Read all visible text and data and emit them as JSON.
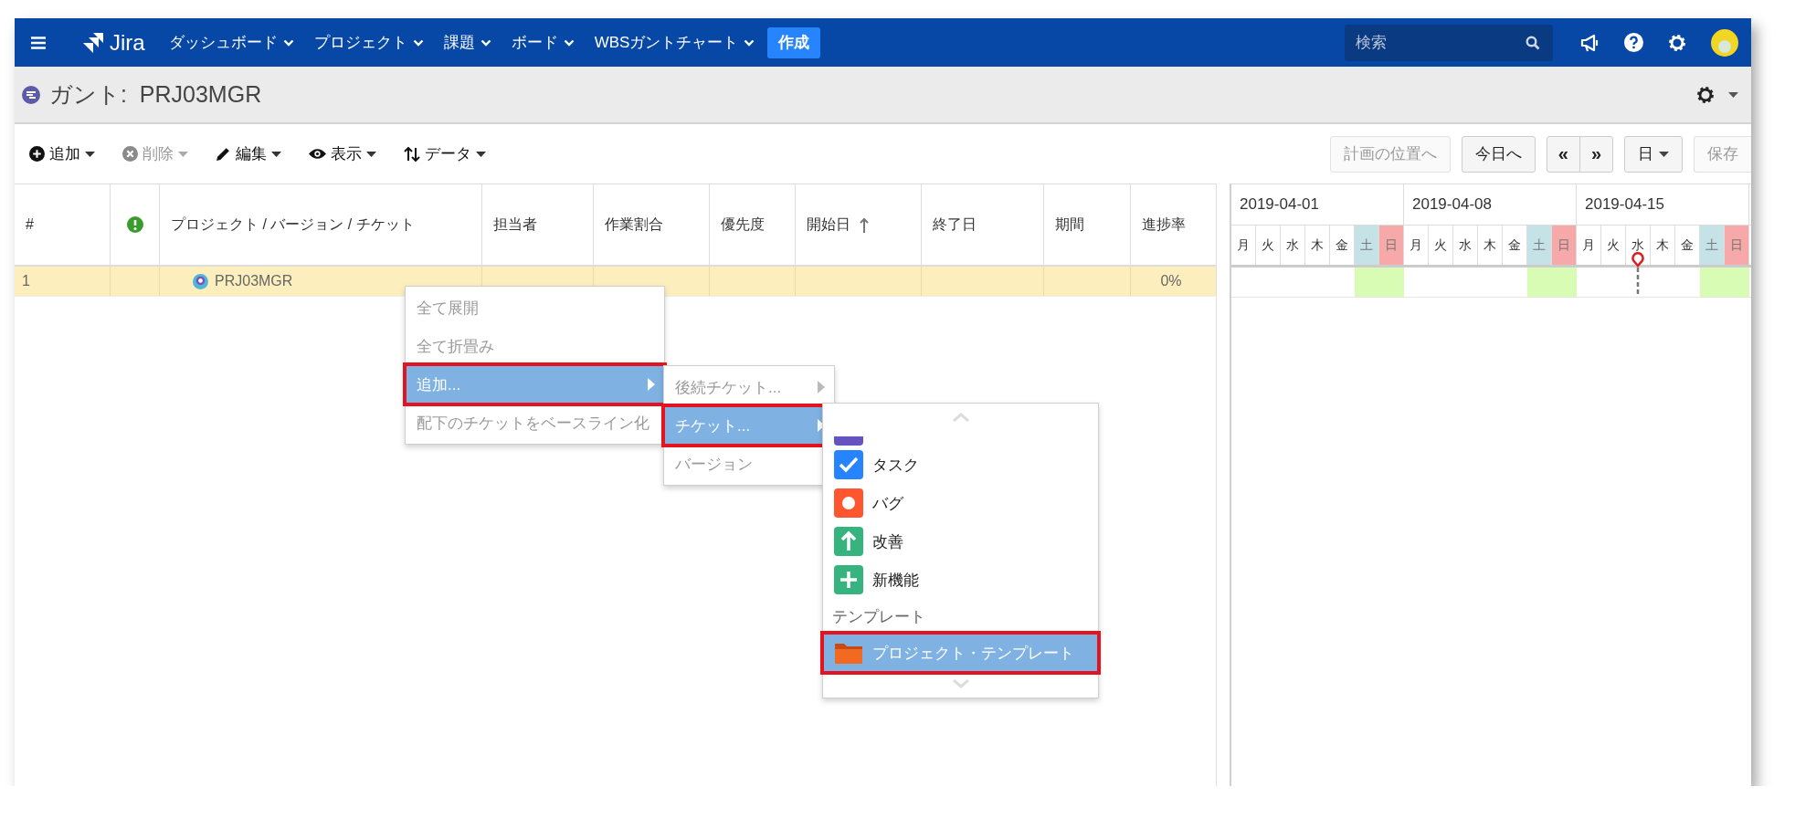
{
  "topbar": {
    "app_name": "Jira",
    "nav": [
      {
        "label": "ダッシュボード"
      },
      {
        "label": "プロジェクト"
      },
      {
        "label": "課題"
      },
      {
        "label": "ボード"
      },
      {
        "label": "WBSガントチャート"
      }
    ],
    "create_button": "作成",
    "search": {
      "placeholder": "検索"
    }
  },
  "title_bar": {
    "title": "ガント:  PRJ03MGR"
  },
  "toolbar": {
    "left": [
      {
        "label": "追加",
        "kind": "add",
        "disabled": false
      },
      {
        "label": "削除",
        "kind": "delete",
        "disabled": true
      },
      {
        "label": "編集",
        "kind": "edit",
        "disabled": false
      },
      {
        "label": "表示",
        "kind": "view",
        "disabled": false
      },
      {
        "label": "データ",
        "kind": "data",
        "disabled": false
      }
    ],
    "right": [
      {
        "label": "計画の位置へ",
        "disabled": true,
        "dropdown": false,
        "joined": false
      },
      {
        "label": "今日へ",
        "disabled": false,
        "dropdown": false,
        "joined": false
      },
      {
        "label": "«",
        "disabled": false,
        "dropdown": false,
        "joined": false
      },
      {
        "label": "»",
        "disabled": false,
        "dropdown": false,
        "joined": true
      },
      {
        "label": "日",
        "disabled": false,
        "dropdown": true,
        "joined": false
      },
      {
        "label": "保存",
        "disabled": true,
        "dropdown": false,
        "joined": false
      }
    ]
  },
  "table": {
    "columns": [
      {
        "label": "#",
        "kind": "text",
        "sorted": false
      },
      {
        "kind": "icon"
      },
      {
        "label": "プロジェクト / バージョン / チケット",
        "kind": "text",
        "sorted": false
      },
      {
        "label": "担当者",
        "kind": "text",
        "sorted": false
      },
      {
        "label": "作業割合",
        "kind": "text",
        "sorted": false
      },
      {
        "label": "優先度",
        "kind": "text",
        "sorted": false
      },
      {
        "label": "開始日",
        "kind": "text",
        "sorted": true
      },
      {
        "label": "終了日",
        "kind": "text",
        "sorted": false
      },
      {
        "label": "期間",
        "kind": "text",
        "sorted": false
      },
      {
        "label": "進捗率",
        "kind": "text",
        "sorted": false
      }
    ],
    "rows": [
      {
        "number": "1",
        "name": "PRJ03MGR",
        "progress": "0%",
        "selected": true
      }
    ]
  },
  "gantt": {
    "weeks": [
      "2019-04-01",
      "2019-04-08",
      "2019-04-15"
    ],
    "days": [
      {
        "label": "月",
        "kind": "weekday",
        "today": false
      },
      {
        "label": "火",
        "kind": "weekday",
        "today": false
      },
      {
        "label": "水",
        "kind": "weekday",
        "today": false
      },
      {
        "label": "木",
        "kind": "weekday",
        "today": false
      },
      {
        "label": "金",
        "kind": "weekday",
        "today": false
      },
      {
        "label": "土",
        "kind": "saturday",
        "today": false
      },
      {
        "label": "日",
        "kind": "sunday",
        "today": false
      },
      {
        "label": "月",
        "kind": "weekday",
        "today": false
      },
      {
        "label": "火",
        "kind": "weekday",
        "today": false
      },
      {
        "label": "水",
        "kind": "weekday",
        "today": false
      },
      {
        "label": "木",
        "kind": "weekday",
        "today": false
      },
      {
        "label": "金",
        "kind": "weekday",
        "today": false
      },
      {
        "label": "土",
        "kind": "saturday",
        "today": false
      },
      {
        "label": "日",
        "kind": "sunday",
        "today": false
      },
      {
        "label": "月",
        "kind": "weekday",
        "today": false
      },
      {
        "label": "火",
        "kind": "weekday",
        "today": false
      },
      {
        "label": "水",
        "kind": "weekday",
        "today": true
      },
      {
        "label": "木",
        "kind": "weekday",
        "today": false
      },
      {
        "label": "金",
        "kind": "weekday",
        "today": false
      },
      {
        "label": "土",
        "kind": "saturday",
        "today": false
      },
      {
        "label": "日",
        "kind": "sunday",
        "today": false
      }
    ]
  },
  "context_menu": {
    "items": [
      {
        "label": "全て展開",
        "disabled": true,
        "selected": false,
        "highlighted": false,
        "submenu": false
      },
      {
        "label": "全て折畳み",
        "disabled": true,
        "selected": false,
        "highlighted": false,
        "submenu": false
      },
      {
        "label": "追加...",
        "disabled": false,
        "selected": true,
        "highlighted": true,
        "submenu": true
      },
      {
        "label": "配下のチケットをベースライン化",
        "disabled": true,
        "selected": false,
        "highlighted": false,
        "submenu": false
      }
    ]
  },
  "add_submenu": {
    "items": [
      {
        "label": "後続チケット...",
        "disabled": true,
        "selected": false,
        "highlighted": false,
        "submenu": true
      },
      {
        "label": "チケット...",
        "disabled": false,
        "selected": true,
        "highlighted": true,
        "submenu": true
      },
      {
        "label": "バージョン",
        "disabled": true,
        "selected": false,
        "highlighted": false,
        "submenu": false
      }
    ]
  },
  "issue_menu": {
    "items": [
      {
        "kind": "epic",
        "selected": false,
        "highlighted": false
      },
      {
        "label": "タスク",
        "kind": "task",
        "selected": false,
        "highlighted": false
      },
      {
        "label": "バグ",
        "kind": "bug",
        "selected": false,
        "highlighted": false
      },
      {
        "label": "改善",
        "kind": "improvement",
        "selected": false,
        "highlighted": false
      },
      {
        "label": "新機能",
        "kind": "feature",
        "selected": false,
        "highlighted": false
      },
      {
        "label": "テンプレート",
        "kind": "header"
      },
      {
        "label": "プロジェクト・テンプレート",
        "kind": "template",
        "selected": true,
        "highlighted": true
      }
    ]
  }
}
